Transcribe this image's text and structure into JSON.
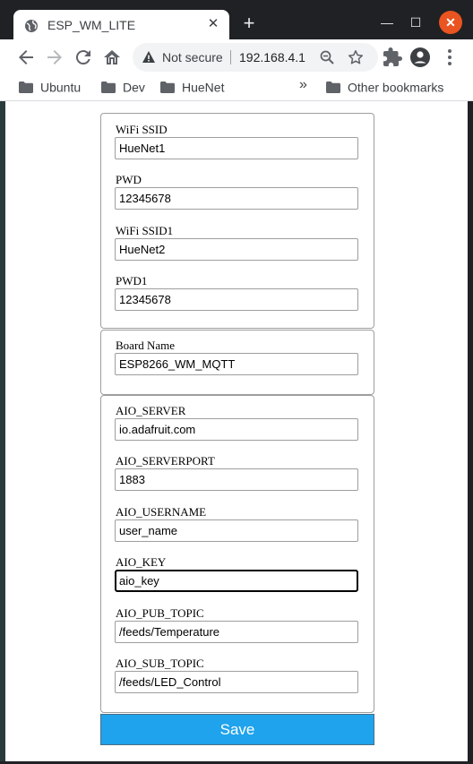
{
  "browser": {
    "tab": {
      "title": "ESP_WM_LITE",
      "close_glyph": "✕"
    },
    "new_tab_glyph": "+",
    "window_controls": {
      "minimize": "—",
      "maximize": "☐",
      "close": "✕"
    },
    "address_bar": {
      "security_text": "Not secure",
      "url": "192.168.4.1"
    },
    "bookmarks": [
      {
        "label": "Ubuntu",
        "icon": "folder-icon"
      },
      {
        "label": "Dev",
        "icon": "folder-icon"
      },
      {
        "label": "HueNet",
        "icon": "folder-icon"
      }
    ],
    "bookmarks_overflow": "»",
    "other_bookmarks": "Other bookmarks",
    "colors": {
      "frame": "#202124",
      "window_close": "#e95420"
    }
  },
  "form": {
    "wifi": [
      {
        "label": "WiFi SSID",
        "value": "HueNet1"
      },
      {
        "label": "PWD",
        "value": "12345678"
      },
      {
        "label": "WiFi SSID1",
        "value": "HueNet2"
      },
      {
        "label": "PWD1",
        "value": "12345678"
      }
    ],
    "board": {
      "label": "Board Name",
      "value": "ESP8266_WM_MQTT"
    },
    "mqtt": [
      {
        "label": "AIO_SERVER",
        "value": "io.adafruit.com"
      },
      {
        "label": "AIO_SERVERPORT",
        "value": "1883"
      },
      {
        "label": "AIO_USERNAME",
        "value": "user_name"
      },
      {
        "label": "AIO_KEY",
        "value": "aio_key",
        "focused": true
      },
      {
        "label": "AIO_PUB_TOPIC",
        "value": "/feeds/Temperature"
      },
      {
        "label": "AIO_SUB_TOPIC",
        "value": "/feeds/LED_Control"
      }
    ],
    "save_label": "Save",
    "colors": {
      "save_button": "#1fa3ec",
      "save_text": "#ffffff"
    }
  }
}
